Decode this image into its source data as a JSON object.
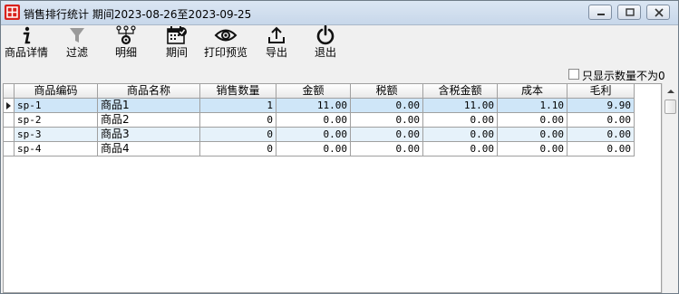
{
  "window": {
    "title": "销售排行统计 期间2023-08-26至2023-09-25"
  },
  "toolbar": {
    "details": "商品详情",
    "filter": "过滤",
    "breakdown": "明细",
    "period": "期间",
    "print_preview": "打印预览",
    "export": "导出",
    "exit": "退出"
  },
  "options": {
    "nonzero_only_label": "只显示数量不为0",
    "nonzero_only_checked": false
  },
  "table": {
    "columns": [
      "商品编码",
      "商品名称",
      "销售数量",
      "金额",
      "税额",
      "含税金额",
      "成本",
      "毛利"
    ],
    "rows": [
      [
        "sp-1",
        "商品1",
        "1",
        "11.00",
        "0.00",
        "11.00",
        "1.10",
        "9.90"
      ],
      [
        "sp-2",
        "商品2",
        "0",
        "0.00",
        "0.00",
        "0.00",
        "0.00",
        "0.00"
      ],
      [
        "sp-3",
        "商品3",
        "0",
        "0.00",
        "0.00",
        "0.00",
        "0.00",
        "0.00"
      ],
      [
        "sp-4",
        "商品4",
        "0",
        "0.00",
        "0.00",
        "0.00",
        "0.00",
        "0.00"
      ]
    ]
  }
}
